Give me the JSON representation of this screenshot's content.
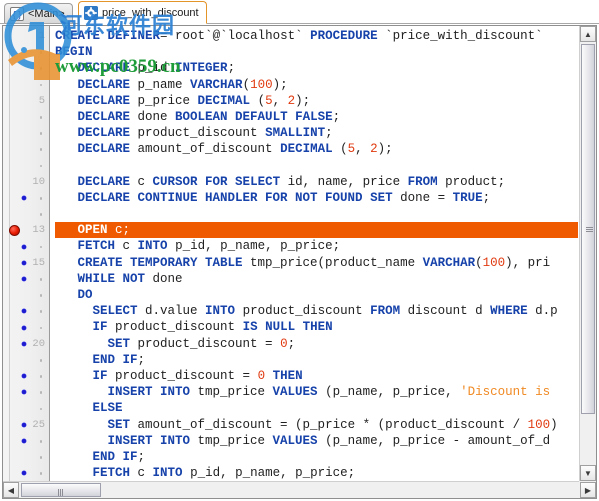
{
  "tabs": [
    {
      "label": "<Main>",
      "icon": "braces-icon",
      "active": false
    },
    {
      "label": "price_with_discount",
      "icon": "gear-icon",
      "active": true
    }
  ],
  "editor": {
    "highlight_line": 13,
    "breakpoint_line": 13,
    "colors": {
      "highlight_bg": "#ef5a00",
      "keyword": "#1642aa",
      "number": "#e03a10",
      "string": "#f08a24",
      "breakpoint": "#e81b00",
      "bookmark_dot": "#1d1dcf",
      "gutter_bg": "#f0f0f0"
    },
    "lines": [
      {
        "n": 1,
        "label": "1",
        "dot": false,
        "tokens": [
          {
            "t": "CREATE DEFINER",
            "c": "kw"
          },
          {
            "t": "=",
            "c": "pln"
          },
          {
            "t": "`root`",
            "c": "idq"
          },
          {
            "t": "@",
            "c": "pln"
          },
          {
            "t": "`localhost`",
            "c": "idq"
          },
          {
            "t": " ",
            "c": "pln"
          },
          {
            "t": "PROCEDURE",
            "c": "kw"
          },
          {
            "t": " ",
            "c": "pln"
          },
          {
            "t": "`price_with_discount`",
            "c": "idq"
          }
        ]
      },
      {
        "n": 2,
        "label": "",
        "dot": false,
        "tokens": [
          {
            "t": "BEGIN",
            "c": "kw"
          }
        ]
      },
      {
        "n": 3,
        "label": "",
        "dot": true,
        "tokens": [
          {
            "t": "   ",
            "c": "pln"
          },
          {
            "t": "DECLARE",
            "c": "kw"
          },
          {
            "t": " p_id ",
            "c": "pln"
          },
          {
            "t": "INTEGER",
            "c": "kw"
          },
          {
            "t": ";",
            "c": "pln"
          }
        ]
      },
      {
        "n": 4,
        "label": "",
        "dot": true,
        "tokens": [
          {
            "t": "   ",
            "c": "pln"
          },
          {
            "t": "DECLARE",
            "c": "kw"
          },
          {
            "t": " p_name ",
            "c": "pln"
          },
          {
            "t": "VARCHAR",
            "c": "kw"
          },
          {
            "t": "(",
            "c": "pln"
          },
          {
            "t": "100",
            "c": "num"
          },
          {
            "t": ");",
            "c": "pln"
          }
        ]
      },
      {
        "n": 5,
        "label": "5",
        "dot": false,
        "tokens": [
          {
            "t": "   ",
            "c": "pln"
          },
          {
            "t": "DECLARE",
            "c": "kw"
          },
          {
            "t": " p_price ",
            "c": "pln"
          },
          {
            "t": "DECIMAL",
            "c": "kw"
          },
          {
            "t": " (",
            "c": "pln"
          },
          {
            "t": "5",
            "c": "num"
          },
          {
            "t": ", ",
            "c": "pln"
          },
          {
            "t": "2",
            "c": "num"
          },
          {
            "t": ");",
            "c": "pln"
          }
        ]
      },
      {
        "n": 6,
        "label": "",
        "dot": true,
        "tokens": [
          {
            "t": "   ",
            "c": "pln"
          },
          {
            "t": "DECLARE",
            "c": "kw"
          },
          {
            "t": " done ",
            "c": "pln"
          },
          {
            "t": "BOOLEAN DEFAULT FALSE",
            "c": "kw"
          },
          {
            "t": ";",
            "c": "pln"
          }
        ]
      },
      {
        "n": 7,
        "label": "",
        "dot": true,
        "tokens": [
          {
            "t": "   ",
            "c": "pln"
          },
          {
            "t": "DECLARE",
            "c": "kw"
          },
          {
            "t": " product_discount ",
            "c": "pln"
          },
          {
            "t": "SMALLINT",
            "c": "kw"
          },
          {
            "t": ";",
            "c": "pln"
          }
        ]
      },
      {
        "n": 8,
        "label": "",
        "dot": true,
        "tokens": [
          {
            "t": "   ",
            "c": "pln"
          },
          {
            "t": "DECLARE",
            "c": "kw"
          },
          {
            "t": " amount_of_discount ",
            "c": "pln"
          },
          {
            "t": "DECIMAL",
            "c": "kw"
          },
          {
            "t": " (",
            "c": "pln"
          },
          {
            "t": "5",
            "c": "num"
          },
          {
            "t": ", ",
            "c": "pln"
          },
          {
            "t": "2",
            "c": "num"
          },
          {
            "t": ");",
            "c": "pln"
          }
        ]
      },
      {
        "n": 9,
        "label": "",
        "dot": true,
        "tokens": []
      },
      {
        "n": 10,
        "label": "10",
        "dot": false,
        "tokens": [
          {
            "t": "   ",
            "c": "pln"
          },
          {
            "t": "DECLARE",
            "c": "kw"
          },
          {
            "t": " c ",
            "c": "pln"
          },
          {
            "t": "CURSOR FOR SELECT",
            "c": "kw"
          },
          {
            "t": " id, name, price ",
            "c": "pln"
          },
          {
            "t": "FROM",
            "c": "kw"
          },
          {
            "t": " product;",
            "c": "pln"
          }
        ]
      },
      {
        "n": 11,
        "label": "",
        "dot": true,
        "bp_dot": true,
        "tokens": [
          {
            "t": "   ",
            "c": "pln"
          },
          {
            "t": "DECLARE CONTINUE HANDLER FOR NOT FOUND SET",
            "c": "kw"
          },
          {
            "t": " done = ",
            "c": "pln"
          },
          {
            "t": "TRUE",
            "c": "kw"
          },
          {
            "t": ";",
            "c": "pln"
          }
        ]
      },
      {
        "n": 12,
        "label": "",
        "dot": true,
        "tokens": []
      },
      {
        "n": 13,
        "label": "13",
        "dot": false,
        "breakpoint": true,
        "highlight": true,
        "tokens": [
          {
            "t": "   ",
            "c": "pln"
          },
          {
            "t": "OPEN",
            "c": "kw"
          },
          {
            "t": " c;",
            "c": "pln"
          }
        ]
      },
      {
        "n": 14,
        "label": "",
        "dot": true,
        "bp_dot": true,
        "tokens": [
          {
            "t": "   ",
            "c": "pln"
          },
          {
            "t": "FETCH",
            "c": "kw"
          },
          {
            "t": " c ",
            "c": "pln"
          },
          {
            "t": "INTO",
            "c": "kw"
          },
          {
            "t": " p_id, p_name, p_price;",
            "c": "pln"
          }
        ]
      },
      {
        "n": 15,
        "label": "15",
        "dot": false,
        "bp_dot": true,
        "tokens": [
          {
            "t": "   ",
            "c": "pln"
          },
          {
            "t": "CREATE TEMPORARY TABLE",
            "c": "kw"
          },
          {
            "t": " tmp_price(product_name ",
            "c": "pln"
          },
          {
            "t": "VARCHAR",
            "c": "kw"
          },
          {
            "t": "(",
            "c": "pln"
          },
          {
            "t": "100",
            "c": "num"
          },
          {
            "t": "), pri",
            "c": "pln"
          }
        ]
      },
      {
        "n": 16,
        "label": "",
        "dot": true,
        "bp_dot": true,
        "tokens": [
          {
            "t": "   ",
            "c": "pln"
          },
          {
            "t": "WHILE NOT",
            "c": "kw"
          },
          {
            "t": " done",
            "c": "pln"
          }
        ]
      },
      {
        "n": 17,
        "label": "",
        "dot": true,
        "tokens": [
          {
            "t": "   ",
            "c": "pln"
          },
          {
            "t": "DO",
            "c": "kw"
          }
        ]
      },
      {
        "n": 18,
        "label": "",
        "dot": true,
        "bp_dot": true,
        "tokens": [
          {
            "t": "     ",
            "c": "pln"
          },
          {
            "t": "SELECT",
            "c": "kw"
          },
          {
            "t": " d.value ",
            "c": "pln"
          },
          {
            "t": "INTO",
            "c": "kw"
          },
          {
            "t": " product_discount ",
            "c": "pln"
          },
          {
            "t": "FROM",
            "c": "kw"
          },
          {
            "t": " discount d ",
            "c": "pln"
          },
          {
            "t": "WHERE",
            "c": "kw"
          },
          {
            "t": " d.p",
            "c": "pln"
          }
        ]
      },
      {
        "n": 19,
        "label": "",
        "dot": true,
        "bp_dot": true,
        "tokens": [
          {
            "t": "     ",
            "c": "pln"
          },
          {
            "t": "IF",
            "c": "kw"
          },
          {
            "t": " product_discount ",
            "c": "pln"
          },
          {
            "t": "IS NULL THEN",
            "c": "kw"
          }
        ]
      },
      {
        "n": 20,
        "label": "20",
        "dot": false,
        "bp_dot": true,
        "tokens": [
          {
            "t": "       ",
            "c": "pln"
          },
          {
            "t": "SET",
            "c": "kw"
          },
          {
            "t": " product_discount = ",
            "c": "pln"
          },
          {
            "t": "0",
            "c": "num"
          },
          {
            "t": ";",
            "c": "pln"
          }
        ]
      },
      {
        "n": 21,
        "label": "",
        "dot": true,
        "tokens": [
          {
            "t": "     ",
            "c": "pln"
          },
          {
            "t": "END IF",
            "c": "kw"
          },
          {
            "t": ";",
            "c": "pln"
          }
        ]
      },
      {
        "n": 22,
        "label": "",
        "dot": true,
        "bp_dot": true,
        "tokens": [
          {
            "t": "     ",
            "c": "pln"
          },
          {
            "t": "IF",
            "c": "kw"
          },
          {
            "t": " product_discount = ",
            "c": "pln"
          },
          {
            "t": "0",
            "c": "num"
          },
          {
            "t": " ",
            "c": "pln"
          },
          {
            "t": "THEN",
            "c": "kw"
          }
        ]
      },
      {
        "n": 23,
        "label": "",
        "dot": true,
        "bp_dot": true,
        "tokens": [
          {
            "t": "       ",
            "c": "pln"
          },
          {
            "t": "INSERT INTO",
            "c": "kw"
          },
          {
            "t": " tmp_price ",
            "c": "pln"
          },
          {
            "t": "VALUES",
            "c": "kw"
          },
          {
            "t": " (p_name, p_price, ",
            "c": "pln"
          },
          {
            "t": "'Discount is",
            "c": "str"
          }
        ]
      },
      {
        "n": 24,
        "label": "",
        "dot": true,
        "tokens": [
          {
            "t": "     ",
            "c": "pln"
          },
          {
            "t": "ELSE",
            "c": "kw"
          }
        ]
      },
      {
        "n": 25,
        "label": "25",
        "dot": false,
        "bp_dot": true,
        "tokens": [
          {
            "t": "       ",
            "c": "pln"
          },
          {
            "t": "SET",
            "c": "kw"
          },
          {
            "t": " amount_of_discount = (p_price * (product_discount / ",
            "c": "pln"
          },
          {
            "t": "100",
            "c": "num"
          },
          {
            "t": ")",
            "c": "pln"
          }
        ]
      },
      {
        "n": 26,
        "label": "",
        "dot": true,
        "bp_dot": true,
        "tokens": [
          {
            "t": "       ",
            "c": "pln"
          },
          {
            "t": "INSERT INTO",
            "c": "kw"
          },
          {
            "t": " tmp_price ",
            "c": "pln"
          },
          {
            "t": "VALUES",
            "c": "kw"
          },
          {
            "t": " (p_name, p_price - amount_of_d",
            "c": "pln"
          }
        ]
      },
      {
        "n": 27,
        "label": "",
        "dot": true,
        "tokens": [
          {
            "t": "     ",
            "c": "pln"
          },
          {
            "t": "END IF",
            "c": "kw"
          },
          {
            "t": ";",
            "c": "pln"
          }
        ]
      },
      {
        "n": 28,
        "label": "",
        "dot": true,
        "bp_dot": true,
        "tokens": [
          {
            "t": "     ",
            "c": "pln"
          },
          {
            "t": "FETCH",
            "c": "kw"
          },
          {
            "t": " c ",
            "c": "pln"
          },
          {
            "t": "INTO",
            "c": "kw"
          },
          {
            "t": " p_id, p_name, p_price;",
            "c": "pln"
          }
        ]
      }
    ]
  },
  "scrollbars": {
    "up_arrow": "▲",
    "down_arrow": "▼",
    "left_arrow": "◀",
    "right_arrow": "▶"
  },
  "watermark": {
    "site_cn": "河东软件园",
    "site_url": "www.pc0359.cn"
  }
}
